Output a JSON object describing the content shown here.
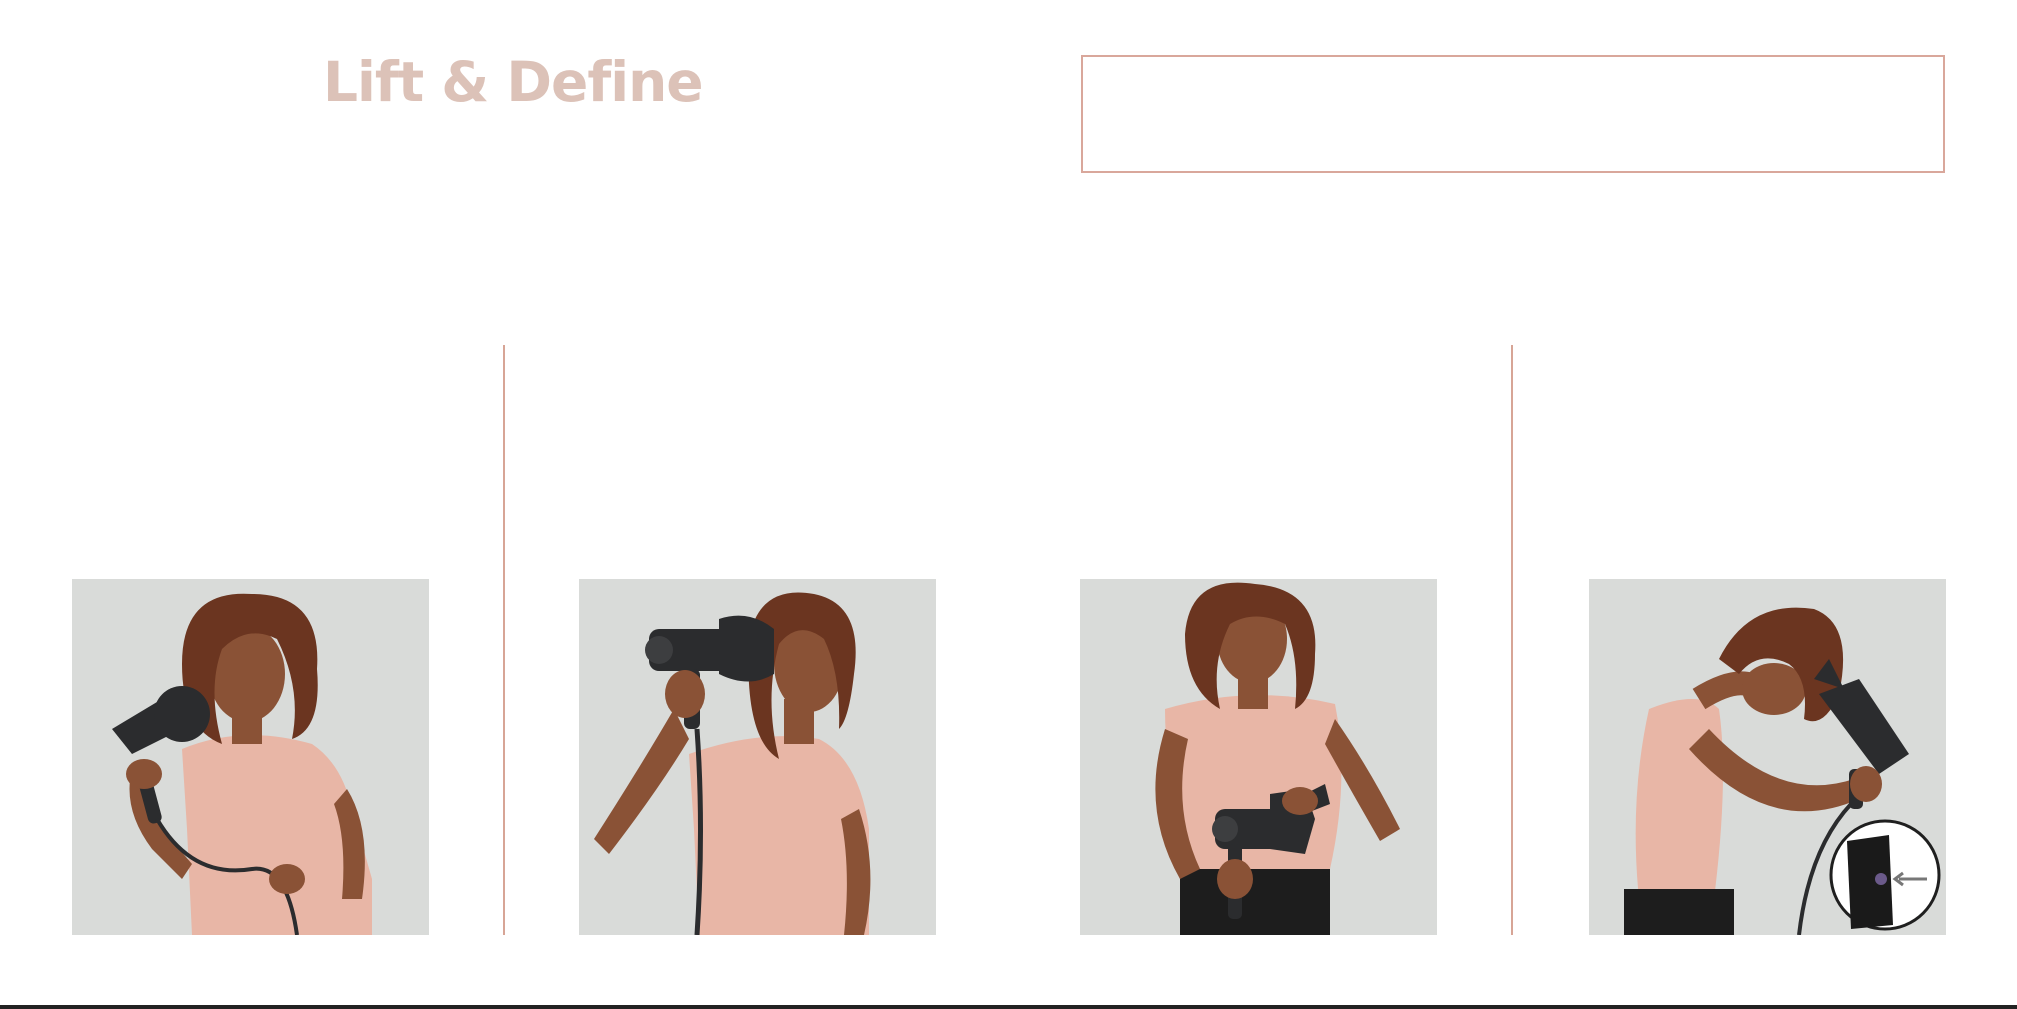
{
  "page": {
    "title": "Lift & Define"
  },
  "colors": {
    "title": "#dcc2b8",
    "accent_rule": "#d7a596",
    "box_border": "#d9a79b",
    "photo_background": "#d9dbd9",
    "shirt": "#e8b6a6",
    "hair": "#6b3520",
    "skin": "#8a5236",
    "dryer": "#2b2c2e"
  },
  "photos": [
    {
      "icon": "person-diffusing-hair-side-photo"
    },
    {
      "icon": "person-drying-hair-raised-arm-photo"
    },
    {
      "icon": "person-attaching-diffuser-photo"
    },
    {
      "icon": "person-diffusing-hair-upside-down-photo",
      "inset_icon": "attachment-release-button-detail-icon"
    }
  ]
}
